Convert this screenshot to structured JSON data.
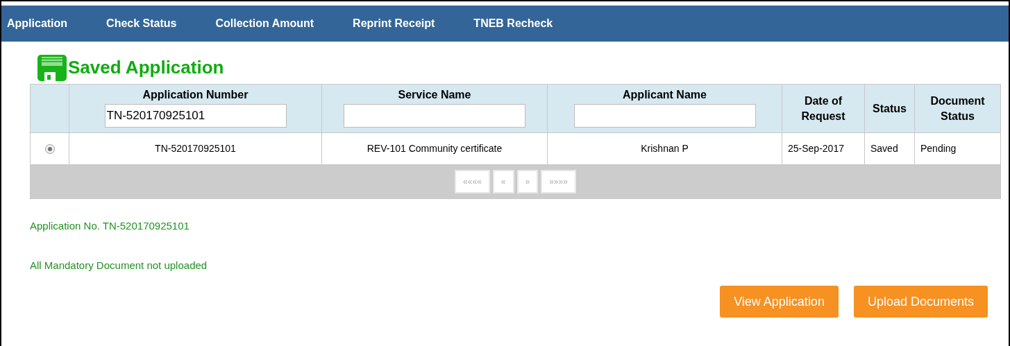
{
  "nav": [
    {
      "label": "Application"
    },
    {
      "label": "Check Status"
    },
    {
      "label": "Collection Amount"
    },
    {
      "label": "Reprint Receipt"
    },
    {
      "label": "TNEB Recheck"
    }
  ],
  "heading": "Saved Application",
  "table": {
    "columns": [
      {
        "label": "Application Number",
        "kind": "filter",
        "filter_value": "TN-520170925101"
      },
      {
        "label": "Service Name",
        "kind": "filter"
      },
      {
        "label": "Applicant Name",
        "kind": "filter"
      },
      {
        "label": "Date of Request",
        "kind": "plain"
      },
      {
        "label": "Status",
        "kind": "plain"
      },
      {
        "label": "Document Status",
        "kind": "plain"
      }
    ],
    "rows": [
      {
        "selected": true,
        "cells": [
          "TN-520170925101",
          "REV-101 Community certificate",
          "Krishnan P",
          "25-Sep-2017",
          "Saved",
          "Pending"
        ]
      }
    ],
    "pager": [
      {
        "label": "««««",
        "disabled": true
      },
      {
        "label": "«",
        "disabled": true
      },
      {
        "label": "»",
        "disabled": true
      },
      {
        "label": "»»»»",
        "disabled": true
      }
    ]
  },
  "messages": [
    "Application No. TN-520170925101",
    "All Mandatory Document not uploaded"
  ],
  "buttons": [
    "View Application",
    "Upload Documents"
  ]
}
